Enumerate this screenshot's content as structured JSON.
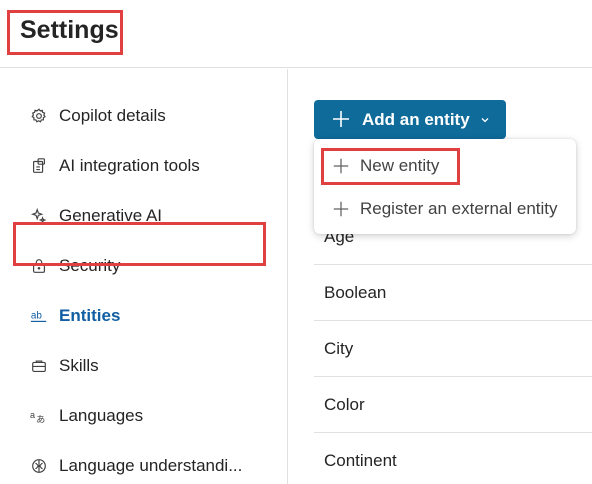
{
  "header": {
    "title": "Settings"
  },
  "sidebar": {
    "items": [
      {
        "label": "Copilot details",
        "icon": "gear-icon"
      },
      {
        "label": "AI integration tools",
        "icon": "ai-tools-icon"
      },
      {
        "label": "Generative AI",
        "icon": "sparkle-icon"
      },
      {
        "label": "Security",
        "icon": "lock-icon"
      },
      {
        "label": "Entities",
        "icon": "entity-ab-icon",
        "selected": true
      },
      {
        "label": "Skills",
        "icon": "briefcase-icon"
      },
      {
        "label": "Languages",
        "icon": "translate-icon"
      },
      {
        "label": "Language understandi...",
        "icon": "brain-icon"
      }
    ]
  },
  "main": {
    "add_button_label": "Add an entity",
    "dropdown": {
      "items": [
        {
          "label": "New entity"
        },
        {
          "label": "Register an external entity"
        }
      ]
    },
    "entities": [
      "Age",
      "Boolean",
      "City",
      "Color",
      "Continent"
    ]
  },
  "colors": {
    "accent": "#0f6b9a",
    "highlight": "#e04040",
    "selected_text": "#115ea3"
  }
}
